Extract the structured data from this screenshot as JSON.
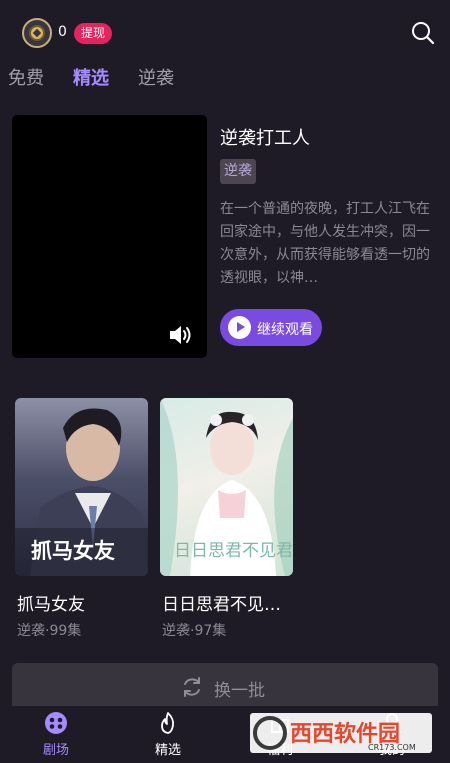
{
  "header": {
    "coin_count": "0",
    "withdraw_label": "提现",
    "icons": {
      "coin": "coin-icon",
      "search": "search-icon"
    }
  },
  "tabs": [
    {
      "label": "免费",
      "active": false
    },
    {
      "label": "精选",
      "active": true
    },
    {
      "label": "逆袭",
      "active": false
    }
  ],
  "feature": {
    "title": "逆袭打工人",
    "tag": "逆袭",
    "description": "在一个普通的夜晚，打工人江飞在回家途中，与他人发生冲突，因一次意外，从而获得能够看透一切的透视眼，以神…",
    "continue_label": "继续观看",
    "icons": {
      "volume": "volume-icon",
      "play": "play-icon"
    }
  },
  "cards": [
    {
      "title": "抓马女友",
      "meta": "逆袭·99集",
      "poster_text": "抓马女友"
    },
    {
      "title": "日日思君不见…",
      "meta": "逆袭·97集",
      "poster_text": "日日思君不见君"
    }
  ],
  "refresh_label": "换一批",
  "bottom_nav": [
    {
      "label": "剧场",
      "icon": "theater-icon",
      "active": true
    },
    {
      "label": "精选",
      "icon": "flame-icon",
      "active": false
    },
    {
      "label": "福利",
      "icon": "gift-icon",
      "active": false
    },
    {
      "label": "我的",
      "icon": "profile-icon",
      "active": false
    }
  ],
  "watermark": {
    "text": "西西软件园",
    "sub": "CR173.COM"
  },
  "colors": {
    "background": "#1e1b27",
    "accent": "#a58bff",
    "button_purple": "#7a4be0",
    "withdraw_red": "#e5245d"
  }
}
